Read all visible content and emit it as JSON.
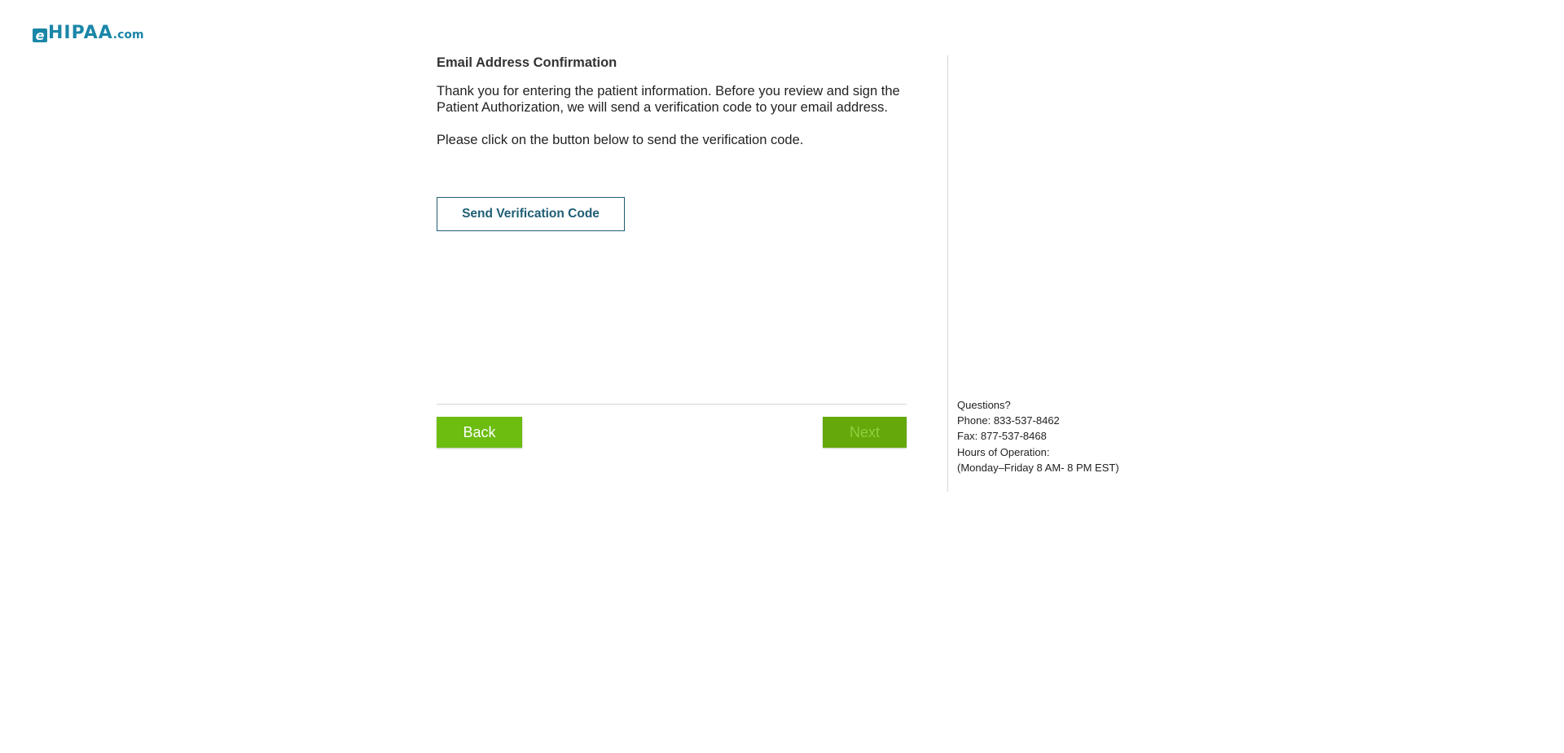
{
  "logo": {
    "e": "e",
    "main": "HIPAA",
    "domain": ".com"
  },
  "main": {
    "title": "Email Address Confirmation",
    "intro": "Thank you for entering the patient information. Before you review and sign the Patient Authorization, we will send a verification code to your email address.",
    "instruction": "Please click on the button below to send the verification code.",
    "send_button_label": "Send Verification Code"
  },
  "footer": {
    "back_label": "Back",
    "next_label": "Next"
  },
  "sidebar": {
    "questions": "Questions?",
    "phone": "Phone: 833-537-8462",
    "fax": "Fax: 877-537-8468",
    "hours_label": "Hours of Operation:",
    "hours": "(Monday–Friday 8 AM- 8 PM EST)"
  },
  "colors": {
    "brand": "#1a86a8",
    "button_green": "#6cbd10",
    "button_green_disabled": "#64a80a",
    "outline_button": "#1f5e74"
  }
}
